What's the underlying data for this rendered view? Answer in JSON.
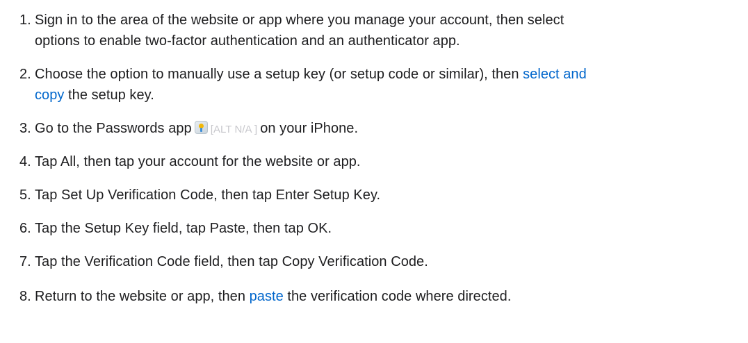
{
  "steps": [
    {
      "number": "1.",
      "line1": "Sign in to the area of the website or app where you manage your account, then select",
      "line2": "options to enable two-factor authentication and an authenticator app."
    },
    {
      "number": "2.",
      "text_before": "Choose the option to manually use a setup key (or setup code or similar), then ",
      "link_part1": "select and",
      "link_part2": "copy",
      "text_after": " the setup key."
    },
    {
      "number": "3.",
      "text_before": "Go to the Passwords app",
      "icon": "passwords-app-icon",
      "alt_text": "[ALT N/A ]",
      "text_after": "on your iPhone."
    },
    {
      "number": "4.",
      "text": "Tap All, then tap your account for the website or app."
    },
    {
      "number": "5.",
      "text": "Tap Set Up Verification Code, then tap Enter Setup Key."
    },
    {
      "number": "6.",
      "text": "Tap the Setup Key field, tap Paste, then tap OK."
    },
    {
      "number": "7.",
      "text": "Tap the Verification Code field, then tap Copy Verification Code."
    },
    {
      "number": "8.",
      "text_before": "Return to the website or app, then ",
      "link": "paste",
      "text_after": " the verification code where directed."
    }
  ],
  "colors": {
    "text": "#1d1d1f",
    "link": "#0066cc",
    "alt_placeholder": "#c7c7cc"
  }
}
